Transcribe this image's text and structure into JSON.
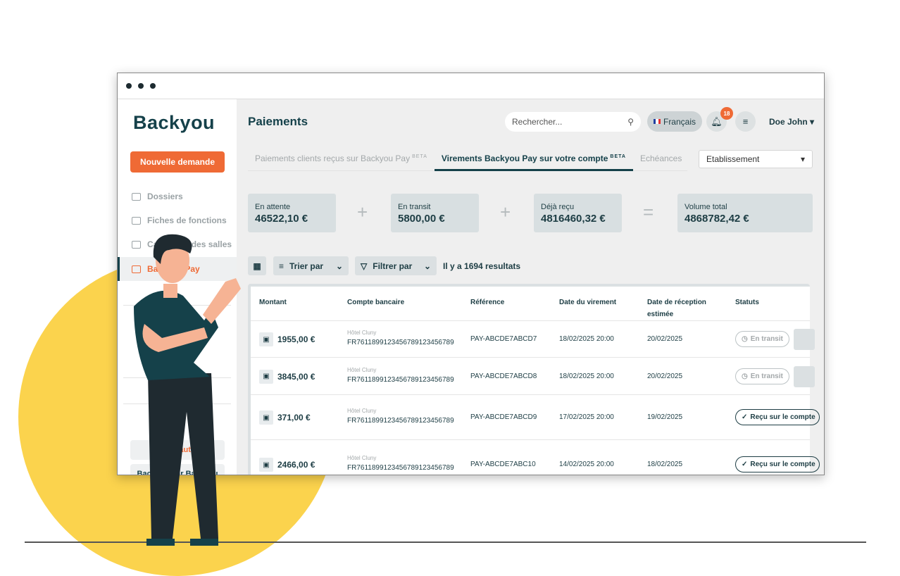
{
  "colors": {
    "accent": "#ef6a35",
    "primary": "#15414a",
    "yellow": "#fbd34d"
  },
  "sidebar": {
    "logo": "Backyou",
    "new_request": "Nouvelle demande",
    "items": [
      {
        "label": "Dossiers",
        "icon": "folder-icon"
      },
      {
        "label": "Fiches de fonctions",
        "icon": "documents-icon"
      },
      {
        "label": "Calendrier des salles",
        "icon": "calendar-icon"
      },
      {
        "label": "Backyou Pay",
        "icon": "card-icon"
      }
    ],
    "bottom_buttons": [
      "Nouveautés",
      "Backyou sur Backyou"
    ]
  },
  "header": {
    "title": "Paiements",
    "search_placeholder": "Rechercher...",
    "language": "Français",
    "notifications": "18",
    "user": "Doe John"
  },
  "tabs": [
    {
      "label": "Paiements clients reçus sur Backyou Pay",
      "badge": "BETA"
    },
    {
      "label": "Virements Backyou Pay sur votre compte",
      "badge": "BETA"
    },
    {
      "label": "Echéances",
      "badge": ""
    }
  ],
  "filter_select": "Etablissement",
  "summary": [
    {
      "label": "En attente",
      "value": "46522,10 €"
    },
    {
      "label": "En transit",
      "value": "5800,00 €"
    },
    {
      "label": "Déjà reçu",
      "value": "4816460,32 €"
    },
    {
      "label": "Volume total",
      "value": "4868782,42 €"
    }
  ],
  "operators": [
    "+",
    "+",
    "="
  ],
  "toolbar": {
    "sort": "Trier par",
    "filter": "Filtrer par",
    "results": "Il y a 1694 resultats"
  },
  "table": {
    "headers": [
      "Montant",
      "Compte bancaire",
      "Référence",
      "Date du virement",
      "Date de réception estimée",
      "Statuts"
    ],
    "rows": [
      {
        "amount": "1955,00 €",
        "hotel": "Hôtel Cluny",
        "iban": "FR7611899123456789123456789",
        "ref": "PAY-ABCDE7ABCD7",
        "date": "18/02/2025 20:00",
        "eta": "20/02/2025",
        "status": "En transit"
      },
      {
        "amount": "3845,00 €",
        "hotel": "Hôtel Cluny",
        "iban": "FR7611899123456789123456789",
        "ref": "PAY-ABCDE7ABCD8",
        "date": "18/02/2025 20:00",
        "eta": "20/02/2025",
        "status": "En transit"
      },
      {
        "amount": "371,00 €",
        "hotel": "Hôtel Cluny",
        "iban": "FR7611899123456789123456789",
        "ref": "PAY-ABCDE7ABCD9",
        "date": "17/02/2025 20:00",
        "eta": "19/02/2025",
        "status": "Reçu sur le compte"
      },
      {
        "amount": "2466,00 €",
        "hotel": "Hôtel Cluny",
        "iban": "FR7611899123456789123456789",
        "ref": "PAY-ABCDE7ABC10",
        "date": "14/02/2025 20:00",
        "eta": "18/02/2025",
        "status": "Reçu sur le compte"
      }
    ]
  }
}
